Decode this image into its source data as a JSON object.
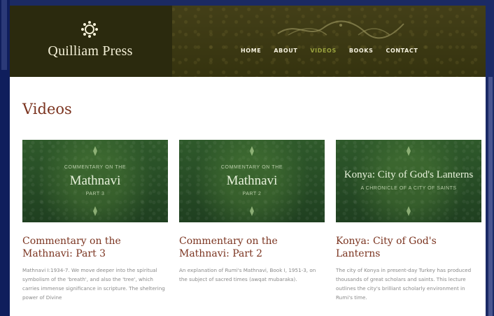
{
  "site": {
    "name": "Quilliam Press"
  },
  "nav": {
    "items": [
      "HOME",
      "ABOUT",
      "VIDEOS",
      "BOOKS",
      "CONTACT"
    ],
    "active_index": 2
  },
  "main": {
    "title": "Videos",
    "cards": [
      {
        "thumb_top": "COMMENTARY ON THE",
        "thumb_main": "Mathnavi",
        "thumb_sub": "PART 3",
        "title": "Commentary on the Mathnavi: Part 3",
        "desc": "Mathnavi I:1934-7. We move deeper into the spiritual symbolism of the 'breath', and also the 'tree', which carries immense significance in scripture. The sheltering power of Divine"
      },
      {
        "thumb_top": "COMMENTARY ON THE",
        "thumb_main": "Mathnavi",
        "thumb_sub": "PART 2",
        "title": "Commentary on the Mathnavi: Part 2",
        "desc": "An explanation of Rumi's Mathnavi, Book I, 1951-3, on the subject of sacred times (awqat mubaraka)."
      },
      {
        "thumb_top": "",
        "thumb_main": "Konya: City of God's Lanterns",
        "thumb_sub": "A CHRONICLE OF A CITY OF SAINTS",
        "title": "Konya: City of God's Lanterns",
        "desc": "The city of Konya in present-day Turkey has produced thousands of great scholars and saints. This lecture outlines the city's brilliant scholarly environment in Rumi's time."
      }
    ]
  },
  "colors": {
    "header_bg": "#3b3815",
    "accent_title": "#7b3420",
    "nav_active": "#9aa33e",
    "thumb_green": "#2f5a2b"
  },
  "icons": {
    "logo": "gear-flower-icon",
    "calligraphy": "arabic-calligraphy"
  }
}
